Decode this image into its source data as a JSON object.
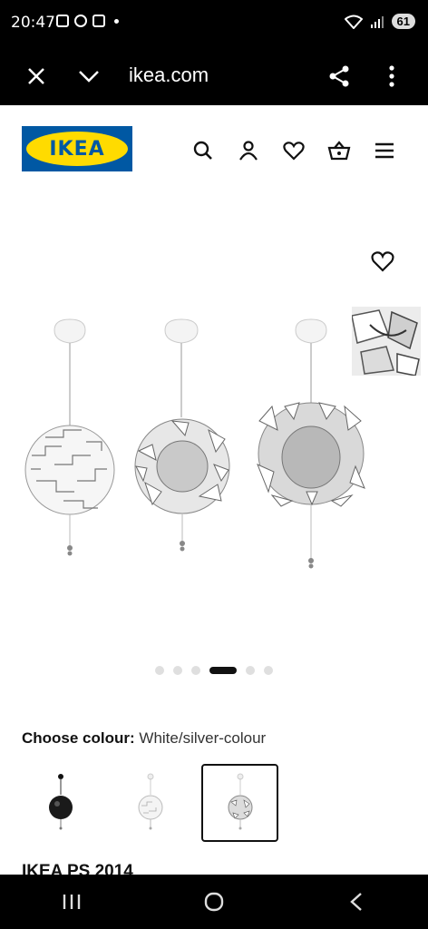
{
  "status_bar": {
    "time": "20:47",
    "battery": "61"
  },
  "browser": {
    "url": "ikea.com"
  },
  "header": {
    "logo_text": "IKEA"
  },
  "gallery": {
    "dot_count": 6,
    "active_dot": 3
  },
  "colour": {
    "label": "Choose colour:",
    "value": "White/silver-colour"
  },
  "product": {
    "name": "IKEA PS 2014"
  },
  "colors": {
    "ikea_blue": "#0058a3",
    "ikea_yellow": "#ffdb00"
  }
}
